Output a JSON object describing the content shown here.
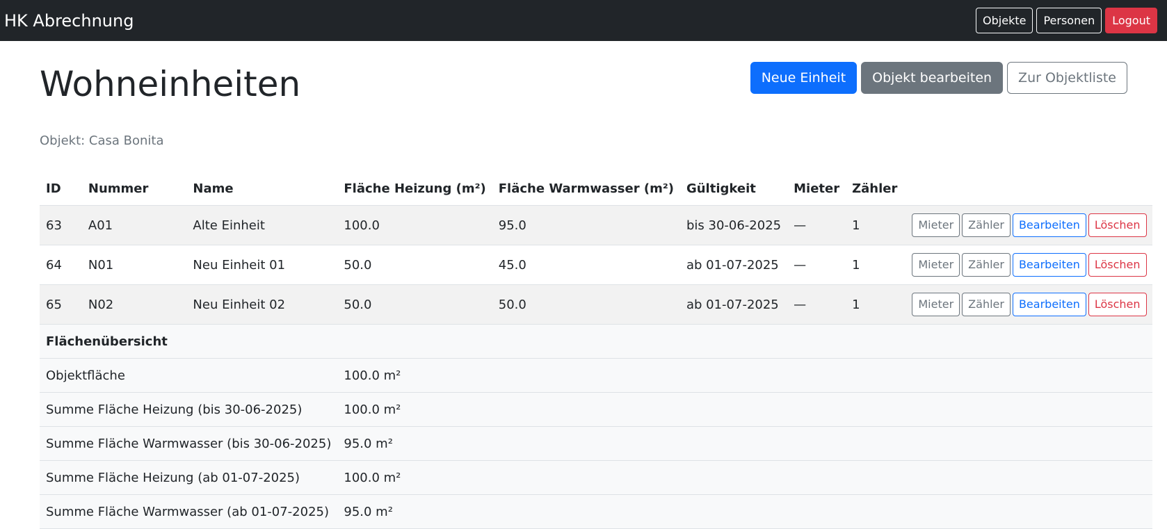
{
  "nav": {
    "brand": "HK Abrechnung",
    "buttons": [
      "Objekte",
      "Personen",
      "Logout"
    ]
  },
  "header": {
    "title": "Wohneinheiten",
    "subtitle": "Objekt: Casa Bonita",
    "actions": [
      "Neue Einheit",
      "Objekt bearbeiten",
      "Zur Objektliste"
    ]
  },
  "table": {
    "columns": [
      "ID",
      "Nummer",
      "Name",
      "Fläche Heizung (m²)",
      "Fläche Warmwasser (m²)",
      "Gültigkeit",
      "Mieter",
      "Zähler"
    ],
    "rows": [
      {
        "id": "63",
        "nummer": "A01",
        "name": "Alte Einheit",
        "heizung": "100.0",
        "warmwasser": "95.0",
        "gueltigkeit": "bis 30-06-2025",
        "mieter": "—",
        "zaehler": "1"
      },
      {
        "id": "64",
        "nummer": "N01",
        "name": "Neu Einheit 01",
        "heizung": "50.0",
        "warmwasser": "45.0",
        "gueltigkeit": "ab 01-07-2025",
        "mieter": "—",
        "zaehler": "1"
      },
      {
        "id": "65",
        "nummer": "N02",
        "name": "Neu Einheit 02",
        "heizung": "50.0",
        "warmwasser": "50.0",
        "gueltigkeit": "ab 01-07-2025",
        "mieter": "—",
        "zaehler": "1"
      }
    ],
    "row_buttons": [
      "Mieter",
      "Zähler",
      "Bearbeiten",
      "Löschen"
    ]
  },
  "summary": {
    "title": "Flächenübersicht",
    "rows": [
      {
        "label": "Objektfläche",
        "value": "100.0 m²"
      },
      {
        "label": "Summe Fläche Heizung (bis 30-06-2025)",
        "value": "100.0 m²"
      },
      {
        "label": "Summe Fläche Warmwasser (bis 30-06-2025)",
        "value": "95.0 m²"
      },
      {
        "label": "Summe Fläche Heizung (ab 01-07-2025)",
        "value": "100.0 m²"
      },
      {
        "label": "Summe Fläche Warmwasser (ab 01-07-2025)",
        "value": "95.0 m²"
      }
    ]
  },
  "colors": {
    "navbar": "#212529",
    "primary": "#0d6efd",
    "secondary": "#6c757d",
    "danger": "#dc3545"
  }
}
